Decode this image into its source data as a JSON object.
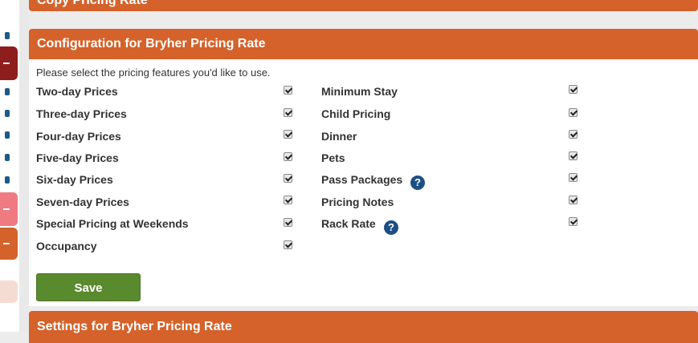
{
  "panels": {
    "copy_title": "Copy Pricing Rate",
    "config_title": "Configuration for Bryher Pricing Rate",
    "settings_title": "Settings for Bryher Pricing Rate"
  },
  "config": {
    "intro": "Please select the pricing features you'd like to use.",
    "left_options": [
      {
        "label": "Two-day Prices",
        "checked": true
      },
      {
        "label": "Three-day Prices",
        "checked": true
      },
      {
        "label": "Four-day Prices",
        "checked": true
      },
      {
        "label": "Five-day Prices",
        "checked": true
      },
      {
        "label": "Six-day Prices",
        "checked": true
      },
      {
        "label": "Seven-day Prices",
        "checked": true
      },
      {
        "label": "Special Pricing at Weekends",
        "checked": true
      },
      {
        "label": "Occupancy",
        "checked": true
      }
    ],
    "right_options": [
      {
        "label": "Minimum Stay",
        "checked": true
      },
      {
        "label": "Child Pricing",
        "checked": true
      },
      {
        "label": "Dinner",
        "checked": true
      },
      {
        "label": "Pets",
        "checked": true
      },
      {
        "label": "Pass Packages",
        "checked": true,
        "help_icon": "?"
      },
      {
        "label": "Pricing Notes",
        "checked": true
      },
      {
        "label": "Rack Rate",
        "checked": true,
        "help_icon": "?"
      }
    ],
    "save_label": "Save"
  },
  "colors": {
    "panel_header": "#d4622a",
    "save_button": "#5a8a2e",
    "help_icon": "#1d4f86",
    "sidebar_icon": "#1d5a88"
  }
}
